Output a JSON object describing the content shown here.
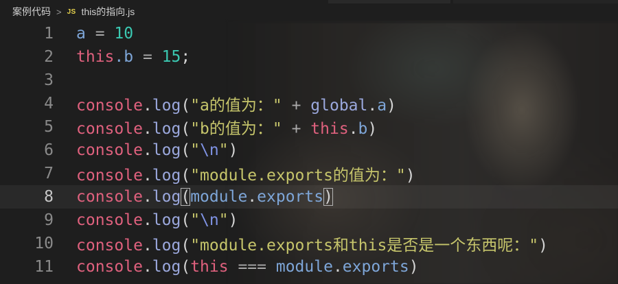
{
  "breadcrumb": {
    "folder": "案例代码",
    "separator": ">",
    "file_icon": "JS",
    "file": "this的指向.js"
  },
  "editor": {
    "current_line": 8,
    "lines": [
      {
        "n": "1",
        "tokens": [
          "a",
          " = ",
          "10"
        ]
      },
      {
        "n": "2",
        "tokens": [
          "this",
          ".b",
          " = ",
          "15",
          ";"
        ]
      },
      {
        "n": "3",
        "tokens": []
      },
      {
        "n": "4",
        "tokens": [
          "console",
          ".",
          "log",
          "(",
          "\"a的值为：\"",
          " + ",
          "global",
          ".",
          "a",
          ")"
        ]
      },
      {
        "n": "5",
        "tokens": [
          "console",
          ".",
          "log",
          "(",
          "\"b的值为：\"",
          " + ",
          "this",
          ".",
          "b",
          ")"
        ]
      },
      {
        "n": "6",
        "tokens": [
          "console",
          ".",
          "log",
          "(",
          "\"",
          "\\n",
          "\"",
          ")"
        ]
      },
      {
        "n": "7",
        "tokens": [
          "console",
          ".",
          "log",
          "(",
          "\"module.exports的值为：\"",
          ")"
        ]
      },
      {
        "n": "8",
        "tokens": [
          "console",
          ".",
          "log",
          "(",
          "module",
          ".",
          "exports",
          ")"
        ]
      },
      {
        "n": "9",
        "tokens": [
          "console",
          ".",
          "log",
          "(",
          "\"",
          "\\n",
          "\"",
          ")"
        ]
      },
      {
        "n": "10",
        "tokens": [
          "console",
          ".",
          "log",
          "(",
          "\"module.exports和this是否是一个东西呢：\"",
          ")"
        ]
      },
      {
        "n": "11",
        "tokens": [
          "console",
          ".",
          "log",
          "(",
          "this",
          " === ",
          "module",
          ".",
          "exports",
          ")"
        ]
      }
    ]
  }
}
